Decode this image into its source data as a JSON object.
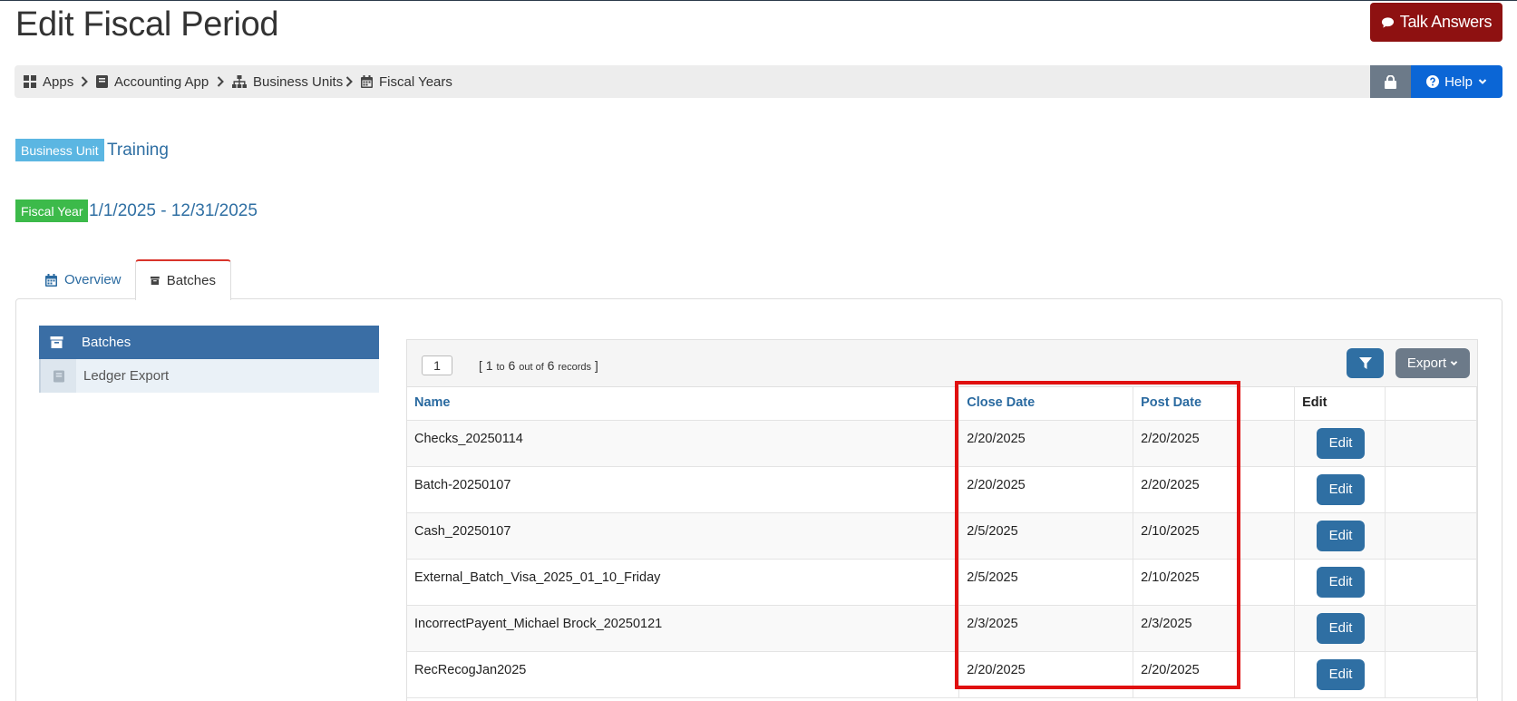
{
  "page": {
    "title": "Edit Fiscal Period"
  },
  "header": {
    "talk_answers_label": "Talk Answers"
  },
  "breadcrumb": [
    {
      "label": "Apps",
      "icon": "th-large-icon"
    },
    {
      "label": "Accounting App",
      "icon": "book-icon"
    },
    {
      "label": "Business Units",
      "icon": "sitemap-icon"
    },
    {
      "label": "Fiscal Years",
      "icon": "calendar-icon"
    }
  ],
  "toolbar": {
    "help_label": "Help"
  },
  "business_unit": {
    "badge": "Business Unit",
    "value": "Training"
  },
  "fiscal_year": {
    "badge": "Fiscal Year",
    "value": "1/1/2025 - 12/31/2025"
  },
  "tabs": [
    {
      "label": "Overview",
      "icon": "calendar-icon",
      "active": false
    },
    {
      "label": "Batches",
      "icon": "archive-icon",
      "active": true
    }
  ],
  "side_nav": [
    {
      "label": "Batches",
      "icon": "archive-icon",
      "active": true
    },
    {
      "label": "Ledger Export",
      "icon": "book-icon",
      "active": false
    }
  ],
  "grid": {
    "page_number": "1",
    "records": {
      "open": "[",
      "from": "1",
      "to_word": "to",
      "to": "6",
      "out_of_word": "out of",
      "total": "6",
      "records_word": "records",
      "close": "]"
    },
    "export_label": "Export",
    "columns": [
      "Name",
      "Close Date",
      "Post Date",
      "Edit",
      ""
    ],
    "rows": [
      {
        "name": "Checks_20250114",
        "close_date": "2/20/2025",
        "post_date": "2/20/2025",
        "edit": "Edit"
      },
      {
        "name": "Batch-20250107",
        "close_date": "2/20/2025",
        "post_date": "2/20/2025",
        "edit": "Edit"
      },
      {
        "name": "Cash_20250107",
        "close_date": "2/5/2025",
        "post_date": "2/10/2025",
        "edit": "Edit"
      },
      {
        "name": "External_Batch_Visa_2025_01_10_Friday",
        "close_date": "2/5/2025",
        "post_date": "2/10/2025",
        "edit": "Edit"
      },
      {
        "name": "IncorrectPayent_Michael Brock_20250121",
        "close_date": "2/3/2025",
        "post_date": "2/3/2025",
        "edit": "Edit"
      },
      {
        "name": "RecRecogJan2025",
        "close_date": "2/20/2025",
        "post_date": "2/20/2025",
        "edit": "Edit"
      }
    ]
  },
  "colors": {
    "accent": "#2f6fa3",
    "talk_button": "#8e1111",
    "help_button": "#0b66d6",
    "highlight": "#e01010",
    "business_unit_badge": "#5bb6e2",
    "fiscal_year_badge": "#3cba4a"
  }
}
